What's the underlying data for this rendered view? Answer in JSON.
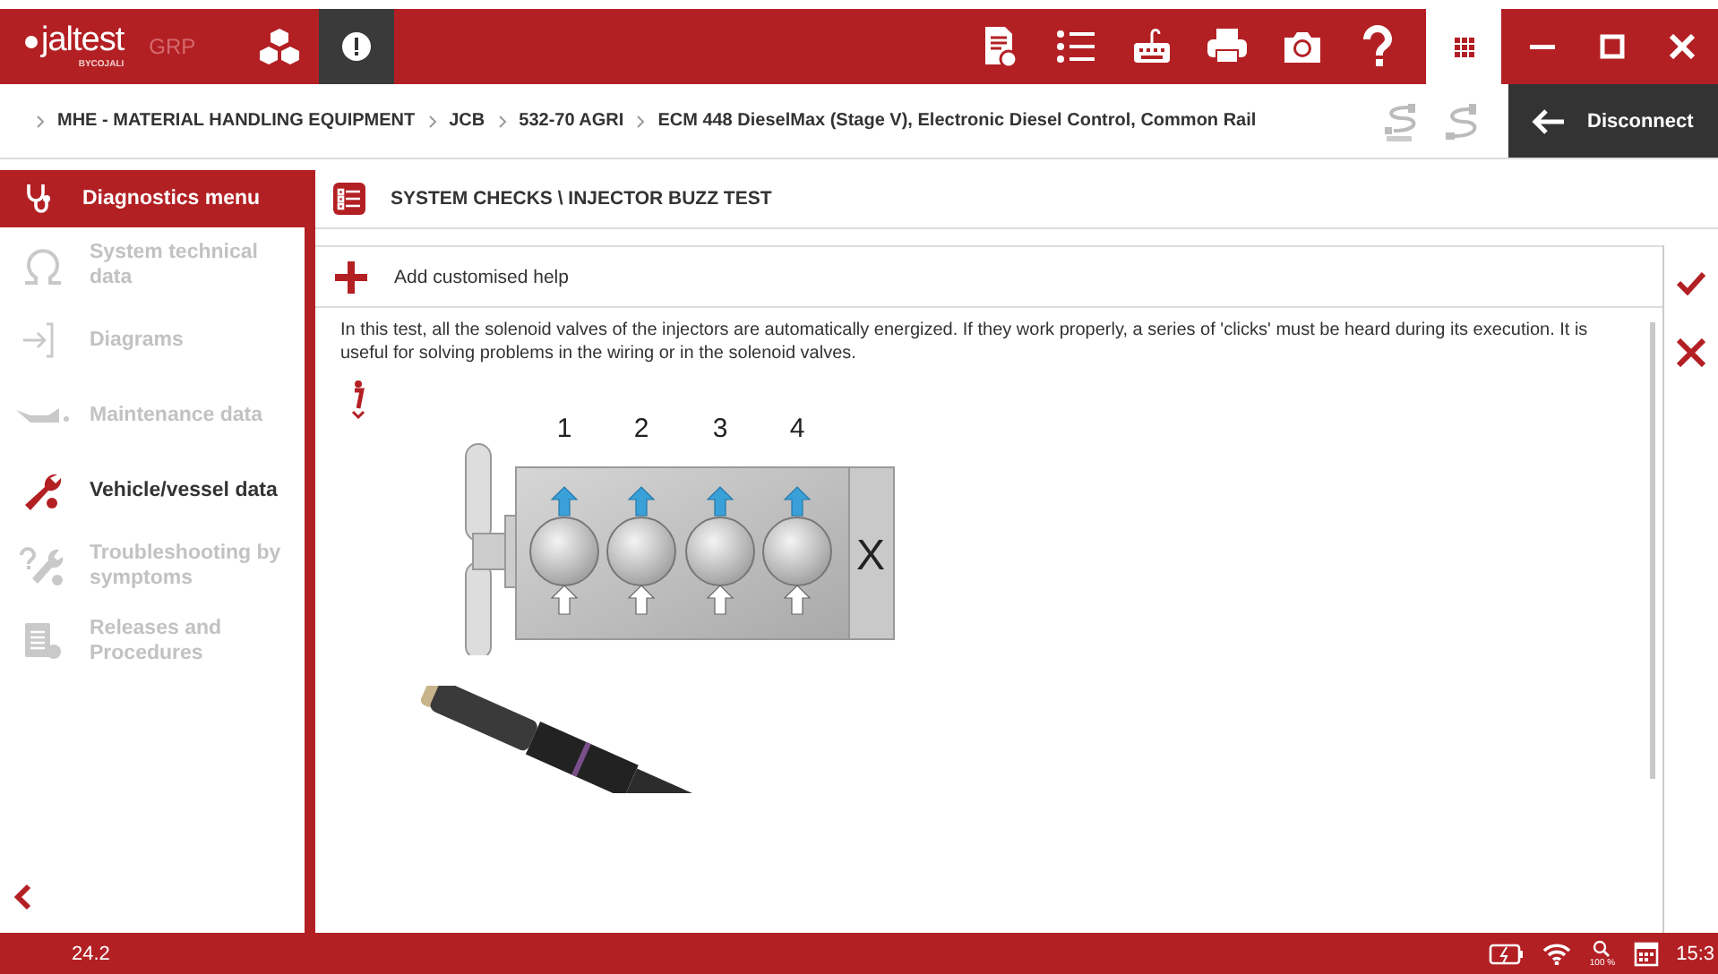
{
  "app": {
    "logo": "jaltest",
    "logo_sub": "BYCOJALI",
    "product": "GRP"
  },
  "breadcrumb": [
    "MHE - MATERIAL HANDLING EQUIPMENT",
    "JCB",
    "532-70 AGRI",
    "ECM 448 DieselMax (Stage V), Electronic Diesel Control, Common Rail"
  ],
  "disconnect": "Disconnect",
  "sidebar": {
    "title": "Diagnostics menu",
    "items": [
      {
        "label": "System technical data",
        "disabled": true
      },
      {
        "label": "Diagrams",
        "disabled": true
      },
      {
        "label": "Maintenance data",
        "disabled": true
      },
      {
        "label": "Vehicle/vessel data",
        "disabled": false
      },
      {
        "label": "Troubleshooting by symptoms",
        "disabled": true
      },
      {
        "label": "Releases and Procedures",
        "disabled": true
      }
    ]
  },
  "page": {
    "title": "SYSTEM CHECKS \\ INJECTOR BUZZ TEST",
    "add_help": "Add customised help",
    "description": "In this test, all the solenoid valves of the injectors are automatically energized. If they work properly, a series of 'clicks' must be heard during its execution. It is useful for solving problems in the wiring or in the solenoid valves.",
    "diagram": {
      "cylinders": [
        "1",
        "2",
        "3",
        "4"
      ],
      "end_label": "X"
    }
  },
  "status_bar": {
    "version": "24.2",
    "zoom": "100 %",
    "time": "15:3"
  }
}
